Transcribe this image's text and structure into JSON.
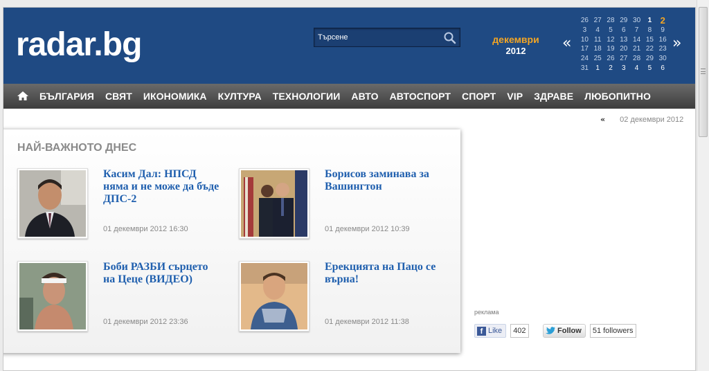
{
  "header": {
    "logo": "radar.bg",
    "search_placeholder": "Търсене",
    "month": "декември",
    "year": "2012",
    "prev_arrow": "«",
    "next_arrow": "»"
  },
  "calendar": {
    "weeks": [
      [
        "26",
        "27",
        "28",
        "29",
        "30",
        "1",
        "2"
      ],
      [
        "3",
        "4",
        "5",
        "6",
        "7",
        "8",
        "9"
      ],
      [
        "10",
        "11",
        "12",
        "13",
        "14",
        "15",
        "16"
      ],
      [
        "17",
        "18",
        "19",
        "20",
        "21",
        "22",
        "23"
      ],
      [
        "24",
        "25",
        "26",
        "27",
        "28",
        "29",
        "30"
      ],
      [
        "31",
        "1",
        "2",
        "3",
        "4",
        "5",
        "6"
      ]
    ],
    "current_day": "2",
    "colors": {
      "accent": "#f5a623",
      "header_bg": "#1f4a83"
    }
  },
  "nav": {
    "items": [
      "БЪЛГАРИЯ",
      "СВЯТ",
      "ИКОНОМИКА",
      "КУЛТУРА",
      "ТЕХНОЛОГИИ",
      "АВТО",
      "АВТОСПОРТ",
      "СПОРТ",
      "VIP",
      "ЗДРАВЕ",
      "ЛЮБОПИТНО"
    ]
  },
  "date_nav": {
    "prev": "«",
    "date": "02 декември 2012"
  },
  "top_stories": {
    "title": "НАЙ-ВАЖНОТО ДНЕС",
    "items": [
      {
        "headline": "Касим Дал: НПСД няма и не може да бъде ДПС-2",
        "time": "01 декември 2012 16:30"
      },
      {
        "headline": "Борисов заминава за Вашингтон",
        "time": "01 декември 2012 10:39"
      },
      {
        "headline": "Боби РАЗБИ сърцето на Цеце (ВИДЕО)",
        "time": "01 декември 2012 23:36"
      },
      {
        "headline": "Ерекцията на Пацо се върна!",
        "time": "01 декември 2012 11:38"
      }
    ]
  },
  "sidebar": {
    "ad_label": "реклама",
    "fb_like": "Like",
    "fb_count": "402",
    "tw_follow": "Follow",
    "tw_count": "51 followers"
  }
}
